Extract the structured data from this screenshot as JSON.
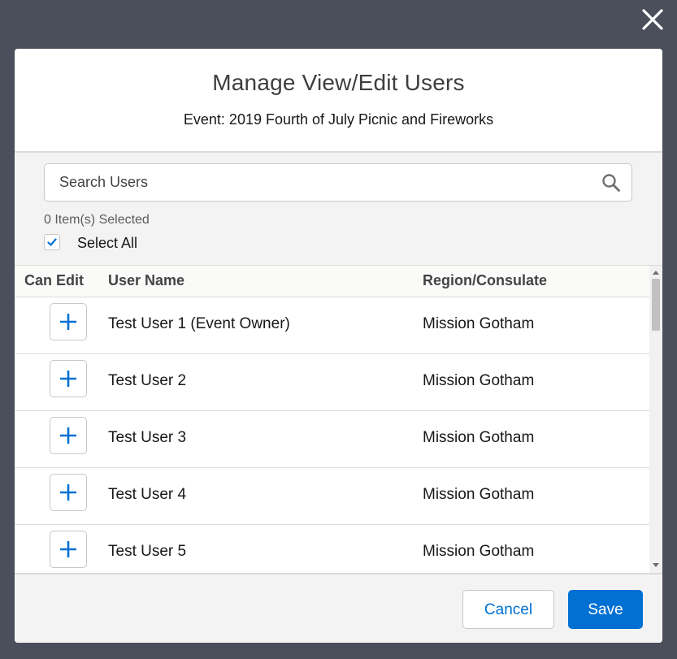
{
  "modal": {
    "title": "Manage View/Edit Users",
    "subtitle": "Event: 2019 Fourth of July Picnic and Fireworks"
  },
  "search": {
    "placeholder": "Search Users",
    "value": ""
  },
  "selection": {
    "count_text": "0 Item(s) Selected",
    "select_all_label": "Select All",
    "select_all_checked": true
  },
  "table": {
    "columns": [
      "Can Edit",
      "User Name",
      "Region/Consulate"
    ],
    "rows": [
      {
        "name": "Test User 1 (Event Owner)",
        "region": "Mission Gotham"
      },
      {
        "name": "Test User 2",
        "region": "Mission Gotham"
      },
      {
        "name": "Test User 3",
        "region": "Mission Gotham"
      },
      {
        "name": "Test User 4",
        "region": "Mission Gotham"
      },
      {
        "name": "Test User 5",
        "region": "Mission Gotham"
      }
    ]
  },
  "footer": {
    "cancel_label": "Cancel",
    "save_label": "Save"
  },
  "icons": {
    "close": "close-icon",
    "search": "search-icon",
    "check": "checkmark-icon",
    "add": "plus-icon"
  },
  "colors": {
    "overlay": "#4a4f5b",
    "brand": "#0070d2",
    "border": "#dddbda"
  }
}
